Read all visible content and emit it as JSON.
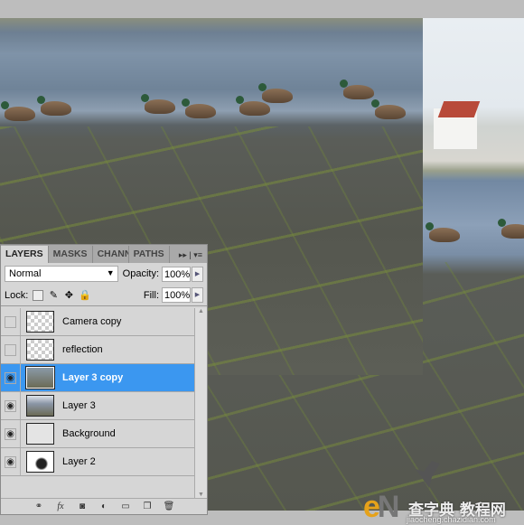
{
  "panel": {
    "tabs": [
      {
        "label": "LAYERS"
      },
      {
        "label": "MASKS"
      },
      {
        "label": "CHANN"
      },
      {
        "label": "PATHS"
      }
    ],
    "tab_menu_icon": "panel-menu-icon",
    "blend_mode": "Normal",
    "opacity_label": "Opacity:",
    "opacity": "100%",
    "lock_label": "Lock:",
    "fill_label": "Fill:",
    "fill": "100%",
    "selection_color": "#3b97f0",
    "layers": [
      {
        "name": "Camera copy",
        "visible": false,
        "thumb": "camera"
      },
      {
        "name": "reflection",
        "visible": false,
        "thumb": "reflection"
      },
      {
        "name": "Layer 3 copy",
        "visible": true,
        "selected": true,
        "thumb": "photo"
      },
      {
        "name": "Layer 3",
        "visible": true,
        "thumb": "photo"
      },
      {
        "name": "Background",
        "visible": true,
        "thumb": "blank"
      },
      {
        "name": "Layer 2",
        "visible": true,
        "thumb": "camera"
      }
    ],
    "footer_icons": [
      "link-icon",
      "fx-icon",
      "mask-icon",
      "adjustment-icon",
      "group-icon",
      "new-layer-icon",
      "trash-icon"
    ]
  },
  "watermark": {
    "logo": "eNet",
    "cn_text": "查字典 教程网",
    "url": "jiaocheng.chazidian.com"
  }
}
